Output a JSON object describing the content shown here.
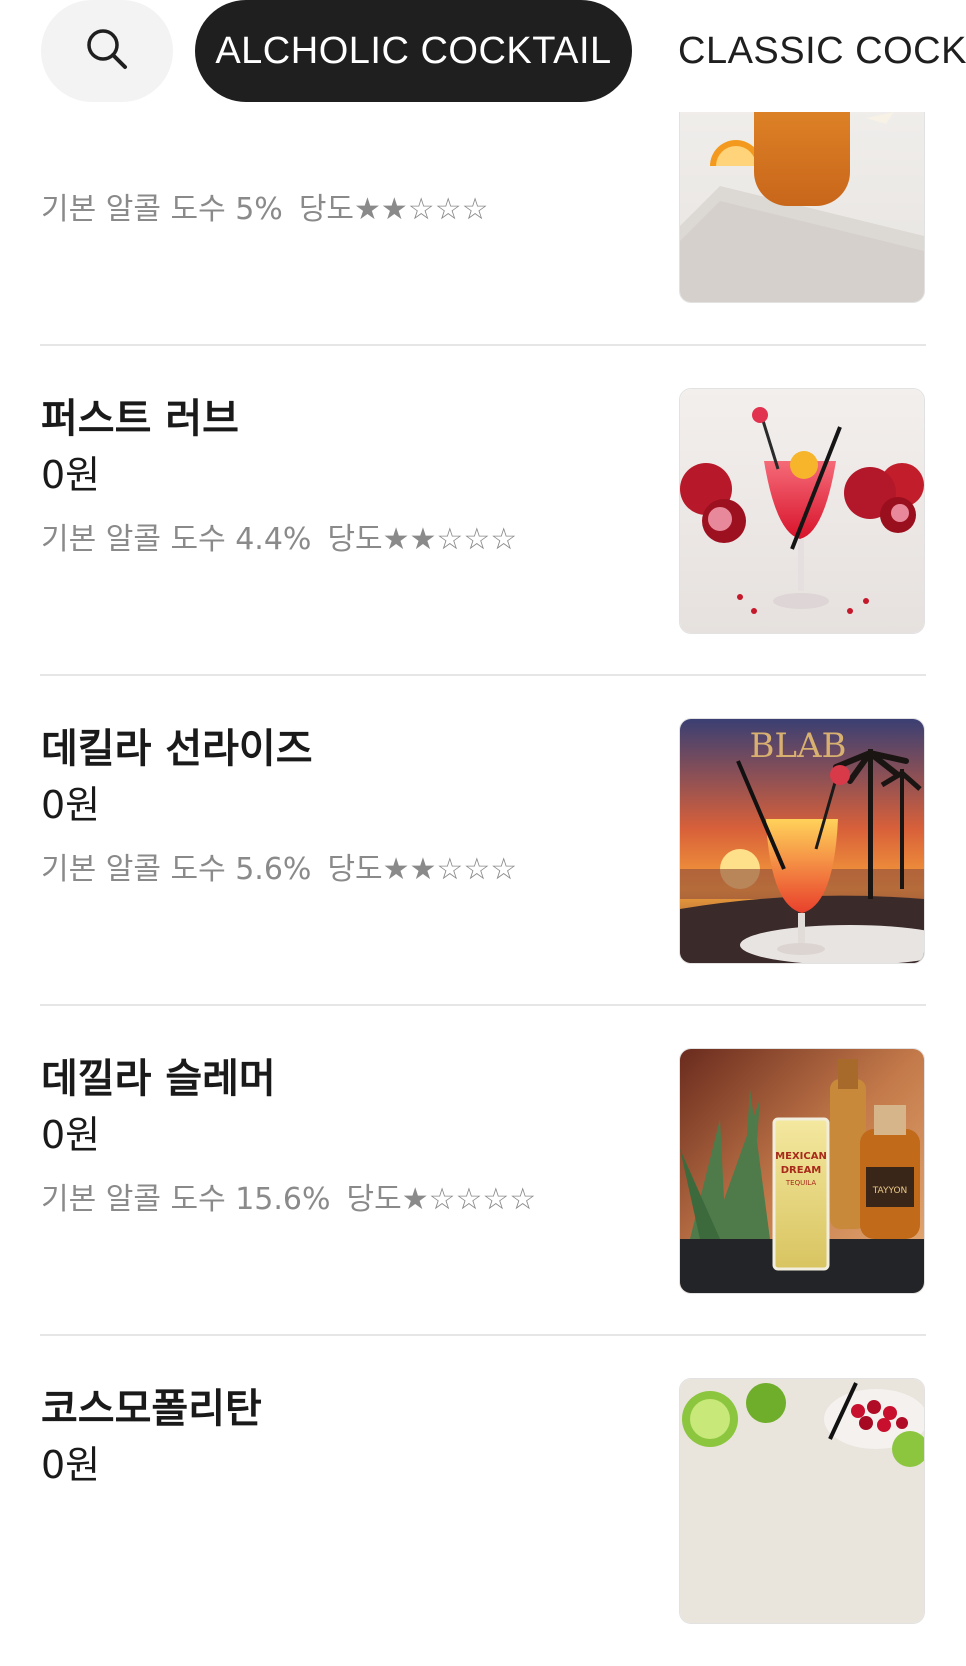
{
  "topbar": {
    "search_icon": "search-icon",
    "active_category": "ALCHOLIC COCKTAIL",
    "next_category": "CLASSIC COCKTAIL"
  },
  "items": [
    {
      "name": "",
      "price": "",
      "abv": "기본 알콜 도수 5%",
      "sweetness": "당도★★☆☆☆",
      "sweetness_level": 2,
      "image": "orange-cocktail-photo"
    },
    {
      "name": "퍼스트 러브",
      "price": "0원",
      "abv": "기본 알콜 도수 4.4%",
      "sweetness": "당도★★☆☆☆",
      "sweetness_level": 2,
      "image": "pomegranate-cocktail-photo"
    },
    {
      "name": "데킬라 선라이즈",
      "price": "0원",
      "abv": "기본 알콜 도수 5.6%",
      "sweetness": "당도★★☆☆☆",
      "sweetness_level": 2,
      "image": "tequila-sunrise-photo",
      "image_text": "BLAB"
    },
    {
      "name": "데낄라 슬레머",
      "price": "0원",
      "abv": "기본 알콜 도수 15.6%",
      "sweetness": "당도★☆☆☆☆",
      "sweetness_level": 1,
      "image": "tequila-slammer-photo",
      "image_text": "MEXICAN DREAM TEQUILA"
    },
    {
      "name": "코스모폴리탄",
      "price": "0원",
      "image": "cosmopolitan-photo"
    }
  ]
}
